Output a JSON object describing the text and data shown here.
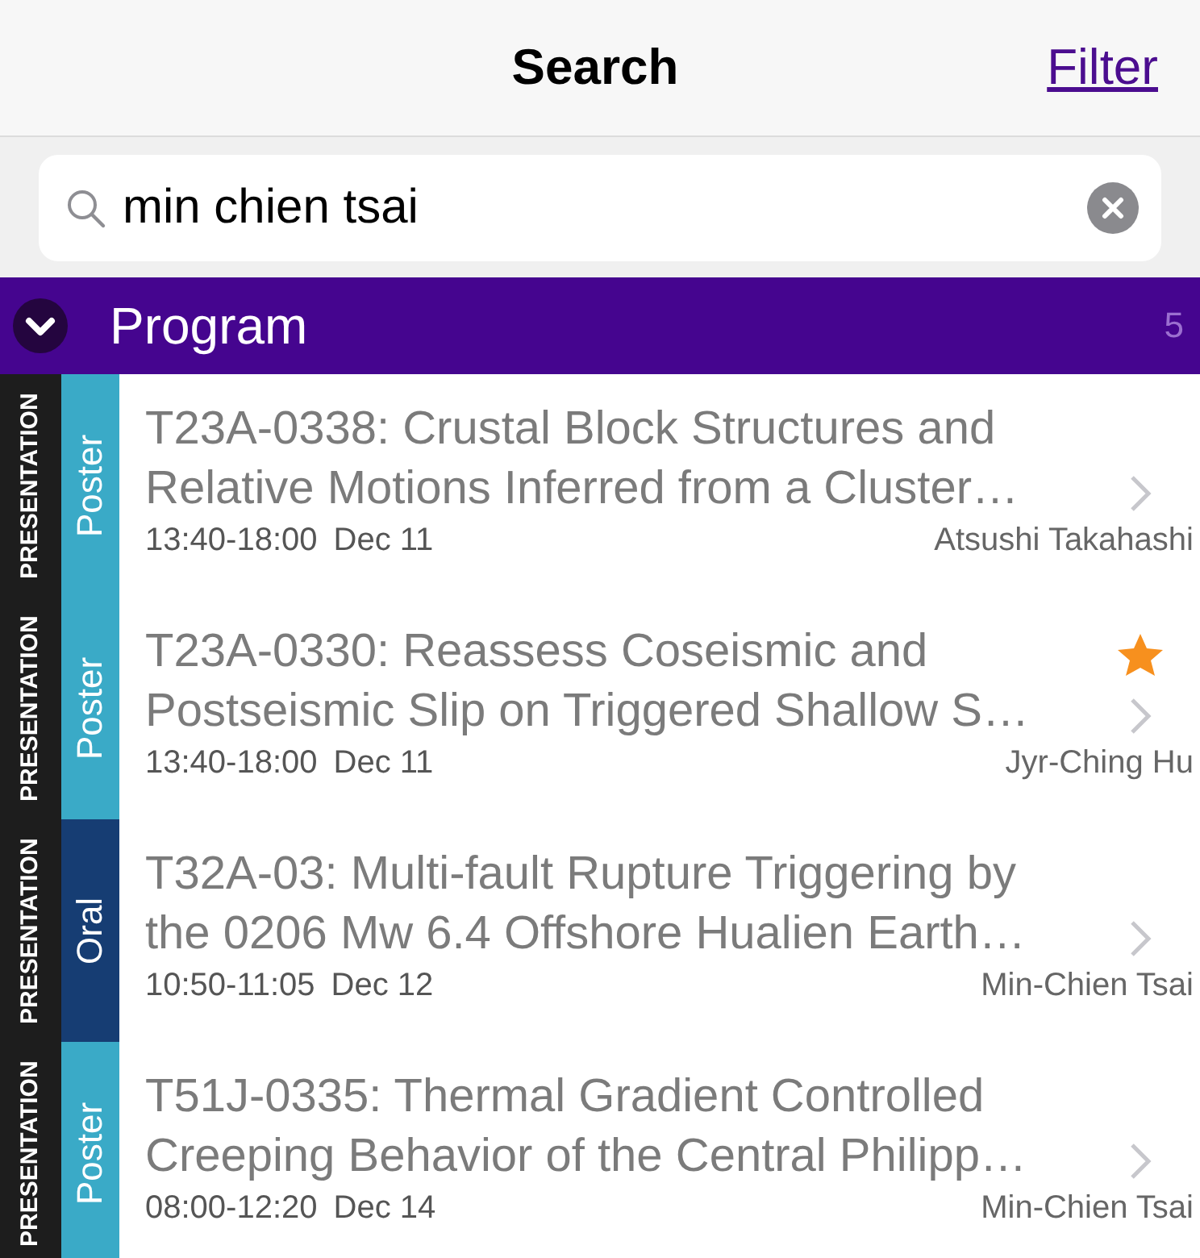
{
  "header": {
    "title": "Search",
    "filter_link": "Filter"
  },
  "search": {
    "value": "min chien tsai"
  },
  "section": {
    "title": "Program",
    "count": "5",
    "expanded": true
  },
  "items": [
    {
      "category": "PRESENTATION",
      "kind": "poster",
      "type_label": "Poster",
      "title": "T23A-0338: Crustal Block Structures and Relative Motions Inferred from a Cluster…",
      "time": "13:40-18:00",
      "date": "Dec 11",
      "author": "Atsushi Takahashi",
      "starred": false
    },
    {
      "category": "PRESENTATION",
      "kind": "poster",
      "type_label": "Poster",
      "title": "T23A-0330: Reassess Coseismic and Postseismic Slip on Triggered Shallow S…",
      "time": "13:40-18:00",
      "date": "Dec 11",
      "author": "Jyr-Ching Hu",
      "starred": true
    },
    {
      "category": "PRESENTATION",
      "kind": "oral",
      "type_label": "Oral",
      "title": "T32A-03: Multi-fault Rupture Triggering by the 0206 Mw 6.4 Offshore Hualien Earth…",
      "time": "10:50-11:05",
      "date": "Dec 12",
      "author": "Min-Chien Tsai",
      "starred": false
    },
    {
      "category": "PRESENTATION",
      "kind": "poster",
      "type_label": "Poster",
      "title": "T51J-0335: Thermal Gradient Controlled Creeping Behavior of the Central Philipp…",
      "time": "08:00-12:20",
      "date": "Dec 14",
      "author": "Min-Chien Tsai",
      "starred": false
    }
  ]
}
